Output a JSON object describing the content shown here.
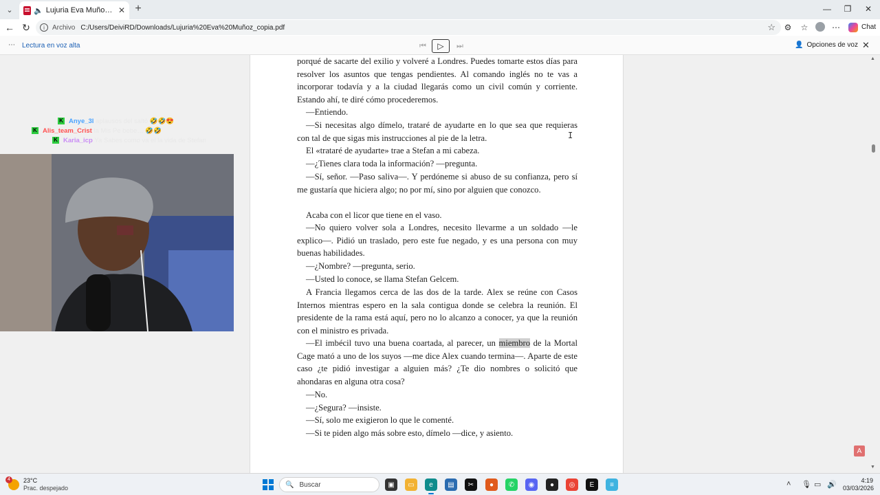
{
  "browser": {
    "tab": {
      "title": "Lujuria Eva Muñoz_copia.pdf"
    },
    "address": {
      "scheme": "Archivo",
      "url": "C:/Users/DeiviRD/Downloads/Lujuria%20Eva%20Muñoz_copia.pdf"
    },
    "chat_label": "Chat"
  },
  "read_aloud": {
    "label": "Lectura en voz alta",
    "voice_options": "Opciones de voz"
  },
  "document": {
    "paragraphs": [
      "porqué de sacarte del exilio y volveré a Londres. Puedes tomarte estos días para resolver los asuntos que tengas pendientes. Al comando inglés no te vas a incorporar todavía y a la ciudad llegarás como un civil común y corriente. Estando ahí, te diré cómo procederemos.",
      "—Entiendo.",
      "—Si necesitas algo dímelo, trataré de ayudarte en lo que sea que requieras con tal de que sigas mis instrucciones al pie de la letra.",
      "El «trataré de ayudarte» trae a Stefan a mi cabeza.",
      "—¿Tienes clara toda la información? —pregunta.",
      "—Sí, señor. —Paso saliva—. Y perdóneme si abuso de su confianza, pero sí me gustaría que hiciera algo; no por mí, sino por alguien que conozco.",
      "Acaba con el licor que tiene en el vaso.",
      "—No quiero volver sola a Londres, necesito llevarme a un soldado —le explico—. Pidió un traslado, pero este fue negado, y es una persona con muy buenas habilidades.",
      "—¿Nombre? —pregunta, serio.",
      "—Usted lo conoce, se llama Stefan Gelcem.",
      "A Francia llegamos cerca de las dos de la tarde. Alex se reúne con Casos Internos mientras espero en la sala contigua donde se celebra la reunión. El presidente de la rama está aquí, pero no lo alcanzo a conocer, ya que la reunión con el ministro es privada.",
      "—¿Segura? —insiste.",
      "—Sí, solo me exigieron lo que le comenté.",
      "—Si te piden algo más sobre esto, dímelo —dice, y asiento."
    ],
    "highlight_para": {
      "before": "—El imbécil tuvo una buena coartada, al parecer, un ",
      "word": "miembro",
      "after": " de la Mortal Cage mató a uno de los suyos —me dice Alex cuando termina—. Aparte de este caso ¿te pidió investigar a alguien más? ¿Te dio nombres o solicitó que ahondaras en alguna otra cosa?"
    },
    "short_line": "—No."
  },
  "stream_chat": [
    {
      "user": "Anye_3l",
      "msg": "aplausos del saltó 🤣🤣😍",
      "color": "#4aa3ff"
    },
    {
      "user": "Alis_team_Crist",
      "msg": "la Mis Pe bebe… 🤣🤣",
      "color": "#ff5050"
    },
    {
      "user": "Karia_icp",
      "msg": "Ya Sabes como va el la vida de Stefan",
      "color": "#c98bf5"
    }
  ],
  "taskbar": {
    "temperature": "23°C",
    "condition": "Prac. despejado",
    "weather_badge": "4",
    "search_placeholder": "Buscar",
    "time": "4:19",
    "date": "03/03/2026"
  },
  "colors": {
    "accent": "#0078d4",
    "pdf_red": "#c8102e",
    "kick_green": "#2ecc40"
  }
}
